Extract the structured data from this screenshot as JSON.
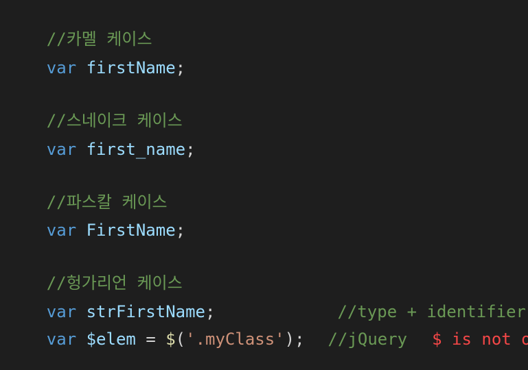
{
  "code": {
    "block1": {
      "comment": "//카멜 케이스",
      "keyword": "var",
      "identifier": "firstName",
      "terminator": ";"
    },
    "block2": {
      "comment": "//스네이크 케이스",
      "keyword": "var",
      "identifier": "first_name",
      "terminator": ";"
    },
    "block3": {
      "comment": "//파스칼 케이스",
      "keyword": "var",
      "identifier": "FirstName",
      "terminator": ";"
    },
    "block4": {
      "comment": "//헝가리언 케이스",
      "line1": {
        "keyword": "var",
        "identifier": "strFirstName",
        "terminator": ";",
        "trailing_comment": "//type + identifier"
      },
      "line2": {
        "keyword": "var",
        "identifier": "$elem",
        "operator": "=",
        "function": "$",
        "open_paren": "(",
        "string": "'.myClass'",
        "close": ");",
        "trailing_comment": "//jQuery",
        "warning_text": "$ is not o"
      }
    }
  },
  "colors": {
    "background": "#1e1e1e",
    "comment": "#6a9955",
    "keyword": "#569cd6",
    "identifier": "#9cdcfe",
    "string": "#ce9178",
    "function": "#dcdcaa",
    "warning": "#f44747"
  }
}
